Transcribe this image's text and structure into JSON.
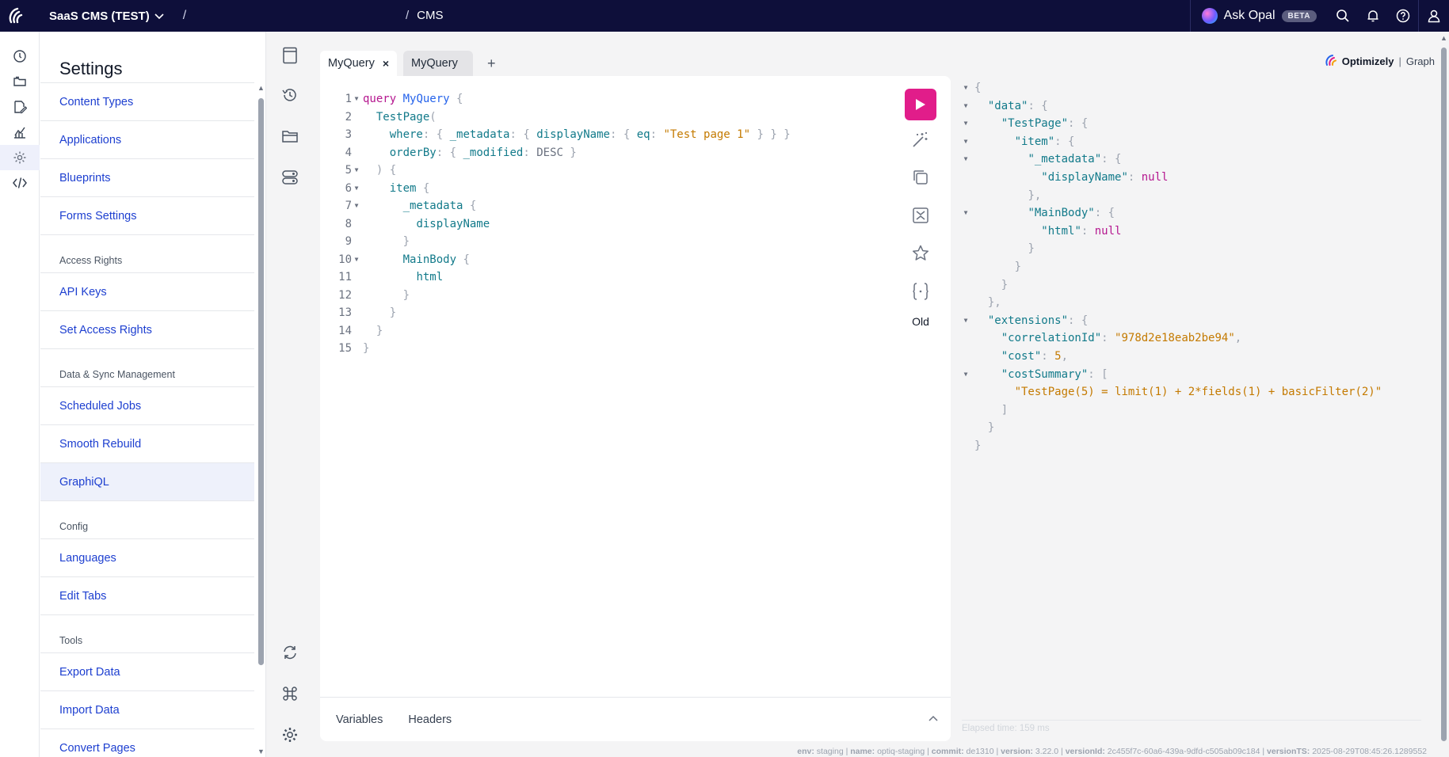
{
  "topbar": {
    "project": "SaaS CMS (TEST)",
    "slash": "/",
    "crumb_sep": "/",
    "crumb": "CMS",
    "ask_opal": "Ask Opal",
    "beta": "BETA"
  },
  "settings": {
    "title": "Settings",
    "items": [
      {
        "type": "item",
        "label": "Content Types"
      },
      {
        "type": "item",
        "label": "Applications"
      },
      {
        "type": "item",
        "label": "Blueprints"
      },
      {
        "type": "item",
        "label": "Forms Settings"
      },
      {
        "type": "group",
        "label": "Access Rights"
      },
      {
        "type": "item",
        "label": "API Keys"
      },
      {
        "type": "item",
        "label": "Set Access Rights"
      },
      {
        "type": "group",
        "label": "Data & Sync Management"
      },
      {
        "type": "item",
        "label": "Scheduled Jobs"
      },
      {
        "type": "item",
        "label": "Smooth Rebuild"
      },
      {
        "type": "item",
        "label": "GraphiQL",
        "active": true
      },
      {
        "type": "group",
        "label": "Config"
      },
      {
        "type": "item",
        "label": "Languages"
      },
      {
        "type": "item",
        "label": "Edit Tabs"
      },
      {
        "type": "group",
        "label": "Tools"
      },
      {
        "type": "item",
        "label": "Export Data"
      },
      {
        "type": "item",
        "label": "Import Data"
      },
      {
        "type": "item",
        "label": "Convert Pages"
      }
    ]
  },
  "tabs": {
    "active": "MyQuery",
    "close": "×",
    "inactive": "MyQuery",
    "add": "+"
  },
  "editor": {
    "old_label": "Old",
    "variables_tab": "Variables",
    "headers_tab": "Headers",
    "lines": [
      {
        "n": "1",
        "fold": true,
        "html": "<span class=\"kw\">query</span> <span class=\"nm\">MyQuery</span> <span class=\"pn\">{</span>"
      },
      {
        "n": "2",
        "fold": false,
        "html": "  <span class=\"fld\">TestPage</span><span class=\"pn\">(</span>"
      },
      {
        "n": "3",
        "fold": false,
        "html": "    <span class=\"arg\">where</span><span class=\"pn\">:</span> <span class=\"pn\">{</span> <span class=\"arg\">_metadata</span><span class=\"pn\">:</span> <span class=\"pn\">{</span> <span class=\"arg\">displayName</span><span class=\"pn\">:</span> <span class=\"pn\">{</span> <span class=\"arg\">eq</span><span class=\"pn\">:</span> <span class=\"str\">\"Test page 1\"</span> <span class=\"pn\">}</span> <span class=\"pn\">}</span> <span class=\"pn\">}</span>"
      },
      {
        "n": "4",
        "fold": false,
        "html": "    <span class=\"arg\">orderBy</span><span class=\"pn\">:</span> <span class=\"pn\">{</span> <span class=\"arg\">_modified</span><span class=\"pn\">:</span> <span class=\"enm\">DESC</span> <span class=\"pn\">}</span>"
      },
      {
        "n": "5",
        "fold": true,
        "html": "  <span class=\"pn\">) {</span>"
      },
      {
        "n": "6",
        "fold": true,
        "html": "    <span class=\"fld\">item</span> <span class=\"pn\">{</span>"
      },
      {
        "n": "7",
        "fold": true,
        "html": "      <span class=\"fld\">_metadata</span> <span class=\"pn\">{</span>"
      },
      {
        "n": "8",
        "fold": false,
        "html": "        <span class=\"fld\">displayName</span>"
      },
      {
        "n": "9",
        "fold": false,
        "html": "      <span class=\"pn\">}</span>"
      },
      {
        "n": "10",
        "fold": true,
        "html": "      <span class=\"fld\">MainBody</span> <span class=\"pn\">{</span>"
      },
      {
        "n": "11",
        "fold": false,
        "html": "        <span class=\"fld\">html</span>"
      },
      {
        "n": "12",
        "fold": false,
        "html": "      <span class=\"pn\">}</span>"
      },
      {
        "n": "13",
        "fold": false,
        "html": "    <span class=\"pn\">}</span>"
      },
      {
        "n": "14",
        "fold": false,
        "html": "  <span class=\"pn\">}</span>"
      },
      {
        "n": "15",
        "fold": false,
        "html": "<span class=\"pn\">}</span>"
      }
    ]
  },
  "result": {
    "brand_name": "Optimizely",
    "brand_sep": "|",
    "brand_product": "Graph",
    "lines": [
      {
        "fold": true,
        "html": "<span class=\"pn\">{</span>"
      },
      {
        "fold": true,
        "html": "  <span class=\"key\">\"data\"</span><span class=\"pn\">: {</span>"
      },
      {
        "fold": true,
        "html": "    <span class=\"key\">\"TestPage\"</span><span class=\"pn\">: {</span>"
      },
      {
        "fold": true,
        "html": "      <span class=\"key\">\"item\"</span><span class=\"pn\">: {</span>"
      },
      {
        "fold": true,
        "html": "        <span class=\"key\">\"_metadata\"</span><span class=\"pn\">: {</span>"
      },
      {
        "fold": false,
        "html": "          <span class=\"key\">\"displayName\"</span><span class=\"pn\">:</span> <span class=\"nul\">null</span>"
      },
      {
        "fold": false,
        "html": "        <span class=\"pn\">},</span>"
      },
      {
        "fold": true,
        "html": "        <span class=\"key\">\"MainBody\"</span><span class=\"pn\">: {</span>"
      },
      {
        "fold": false,
        "html": "          <span class=\"key\">\"html\"</span><span class=\"pn\">:</span> <span class=\"nul\">null</span>"
      },
      {
        "fold": false,
        "html": "        <span class=\"pn\">}</span>"
      },
      {
        "fold": false,
        "html": "      <span class=\"pn\">}</span>"
      },
      {
        "fold": false,
        "html": "    <span class=\"pn\">}</span>"
      },
      {
        "fold": false,
        "html": "  <span class=\"pn\">},</span>"
      },
      {
        "fold": true,
        "html": "  <span class=\"key\">\"extensions\"</span><span class=\"pn\">: {</span>"
      },
      {
        "fold": false,
        "html": "    <span class=\"key\">\"correlationId\"</span><span class=\"pn\">:</span> <span class=\"sv\">\"978d2e18eab2be94\"</span><span class=\"pn\">,</span>"
      },
      {
        "fold": false,
        "html": "    <span class=\"key\">\"cost\"</span><span class=\"pn\">:</span> <span class=\"nv\">5</span><span class=\"pn\">,</span>"
      },
      {
        "fold": true,
        "html": "    <span class=\"key\">\"costSummary\"</span><span class=\"pn\">: [</span>"
      },
      {
        "fold": false,
        "html": "      <span class=\"sv\">\"TestPage(5) = limit(1) + 2*fields(1) + basicFilter(2)\"</span>"
      },
      {
        "fold": false,
        "html": "    <span class=\"pn\">]</span>"
      },
      {
        "fold": false,
        "html": "  <span class=\"pn\">}</span>"
      },
      {
        "fold": false,
        "html": "<span class=\"pn\">}</span>"
      }
    ],
    "elapsed": "Elapsed time: 159 ms"
  },
  "footer": {
    "env_label": "env:",
    "env": "staging",
    "name_label": "name:",
    "name": "optiq-staging",
    "commit_label": "commit:",
    "commit": "de1310",
    "version_label": "version:",
    "version": "3.22.0",
    "versionid_label": "versionId:",
    "versionid": "2c455f7c-60a6-439a-9dfd-c505ab09c184",
    "versionts_label": "versionTS:",
    "versionts": "2025-08-29T08:45:26.1289552"
  },
  "colors": {
    "topbar": "#0e0f3a",
    "link": "#1d3fd0",
    "run": "#e11d8a"
  }
}
